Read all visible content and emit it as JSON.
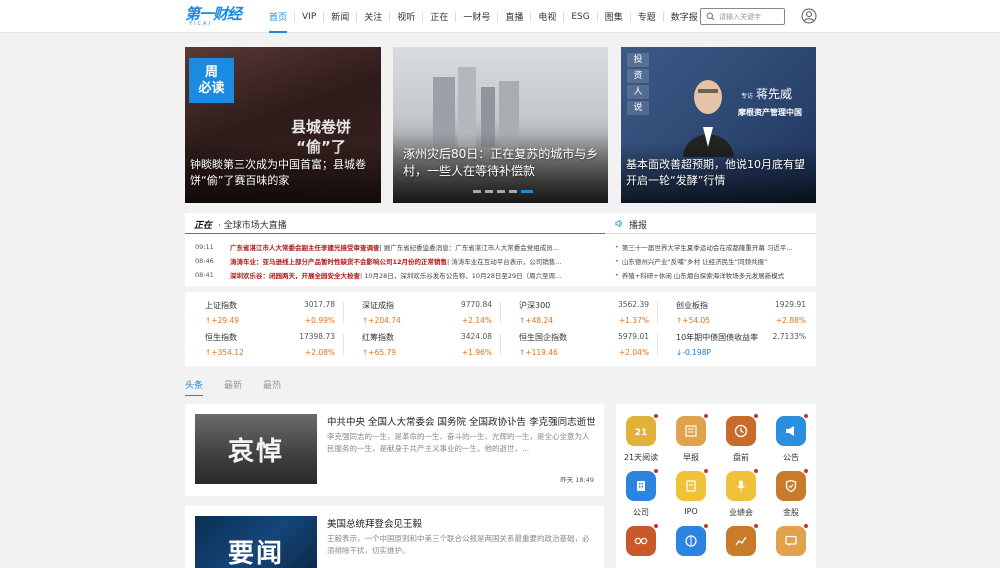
{
  "header": {
    "logo_text": "第一财经",
    "logo_sub": "YICAI",
    "nav": [
      {
        "label": "首页",
        "active": true
      },
      {
        "label": "VIP"
      },
      {
        "label": "新闻"
      },
      {
        "label": "关注"
      },
      {
        "label": "视听"
      },
      {
        "label": "正在"
      },
      {
        "label": "一财号"
      },
      {
        "label": "直播"
      },
      {
        "label": "电视"
      },
      {
        "label": "ESG"
      },
      {
        "label": "图集"
      },
      {
        "label": "专题"
      },
      {
        "label": "数字报"
      }
    ],
    "search_placeholder": "请输入关键字"
  },
  "hero": [
    {
      "caption": "钟睒睒第三次成为中国首富；县城卷饼“偷”了赛百味的家",
      "badge_line1": "周",
      "badge_line2": "必读",
      "overlay_title_1": "县城卷饼",
      "overlay_title_2": "“偷”了"
    },
    {
      "caption": "涿州灾后80日：正在复苏的城市与乡村，一些人在等待补偿款"
    },
    {
      "caption": "基本面改善超预期，他说10月底有望开启一轮“发酵”行情",
      "tag1": "投",
      "tag2": "资",
      "tag3": "人",
      "tag4": "说",
      "guest_prefix": "专访",
      "guest_name": "蒋先威",
      "org": "摩根资产管理中国"
    }
  ],
  "live": {
    "logo": "正在",
    "title": "· 全球市场大直播",
    "items": [
      {
        "time": "09:11",
        "headline": "广东省湛江市人大常委会副主任李建光接受审查调查",
        "body": "| 据广东省纪委监委消息：广东省湛江市人大常委会党组成员..."
      },
      {
        "time": "08:46",
        "headline": "涛涛车业：亚马逊线上部分产品暂时性缺货不会影响公司12月份的正常销售",
        "body": "| 涛涛车业在互动平台表示，公司销售..."
      },
      {
        "time": "08:41",
        "headline": "深圳欢乐谷：闭园两天，开展全园安全大检查",
        "body": "| 10月28日，深圳欢乐谷发布公告称，10月28日至29日（周六至周..."
      }
    ],
    "broadcast_title": "播报",
    "broadcast": [
      "第三十一届世界大学生夏季运动会在成都隆重开幕 习近平...",
      "山东德州兴产业“反哺”乡村 让经济民生“同频共振”",
      "养殖+科研+休闲 山东烟台探索海洋牧场多元发展新模式"
    ]
  },
  "indices": [
    {
      "name": "上证指数",
      "value": "3017.78",
      "change": "+29.49",
      "pct": "+0.99%",
      "dir": "up"
    },
    {
      "name": "深证成指",
      "value": "9770.84",
      "change": "+204.74",
      "pct": "+2.14%",
      "dir": "up"
    },
    {
      "name": "沪深300",
      "value": "3562.39",
      "change": "+48.24",
      "pct": "+1.37%",
      "dir": "up"
    },
    {
      "name": "创业板指",
      "value": "1929.91",
      "change": "+54.05",
      "pct": "+2.88%",
      "dir": "up"
    },
    {
      "name": "恒生指数",
      "value": "17398.73",
      "change": "+354.12",
      "pct": "+2.08%",
      "dir": "up"
    },
    {
      "name": "红筹指数",
      "value": "3424.08",
      "change": "+65.79",
      "pct": "+1.96%",
      "dir": "up"
    },
    {
      "name": "恒生国企指数",
      "value": "5979.01",
      "change": "+119.46",
      "pct": "+2.04%",
      "dir": "up"
    },
    {
      "name": "10年期中债国债收益率",
      "value": "2.7133%",
      "change": "-0.198P",
      "pct": "",
      "dir": "down"
    }
  ],
  "tabs": [
    {
      "label": "头条",
      "active": true
    },
    {
      "label": "最新"
    },
    {
      "label": "最热"
    }
  ],
  "news": [
    {
      "thumb_text": "哀悼",
      "title": "中共中央 全国人大常委会 国务院 全国政协讣告 李克强同志逝世",
      "desc": "李克强同志的一生，是革命的一生、奋斗的一生、光辉的一生，是全心全意为人民服务的一生，是献身于共产主义事业的一生。他的逝世，...",
      "time": "昨天 18:49"
    },
    {
      "thumb_text": "要闻",
      "title": "美国总统拜登会见王毅",
      "desc": "王毅表示，一个中国原则和中美三个联合公报是两国关系最重要的政治基础，必须排除干扰，切实维护。",
      "time": ""
    }
  ],
  "services": [
    {
      "label": "21天阅读",
      "icon": "reading-icon",
      "color": "#e0b238"
    },
    {
      "label": "早报",
      "icon": "newspaper-icon",
      "color": "#e0a24a"
    },
    {
      "label": "盘前",
      "icon": "clock-icon",
      "color": "#c96b2b"
    },
    {
      "label": "公告",
      "icon": "megaphone-icon",
      "color": "#2b8fe0"
    },
    {
      "label": "公司",
      "icon": "company-icon",
      "color": "#2b84e0"
    },
    {
      "label": "IPO",
      "icon": "ipo-icon",
      "color": "#f0c23a"
    },
    {
      "label": "业绩会",
      "icon": "microphone-icon",
      "color": "#f0c23a"
    },
    {
      "label": "金股",
      "icon": "shield-icon",
      "color": "#c97a2b"
    },
    {
      "label": "",
      "icon": "glasses-icon",
      "color": "#c9582b"
    },
    {
      "label": "",
      "icon": "brain-icon",
      "color": "#2b84e0"
    },
    {
      "label": "",
      "icon": "chart-icon",
      "color": "#c97a2b"
    },
    {
      "label": "",
      "icon": "message-icon",
      "color": "#e0a24a"
    }
  ]
}
